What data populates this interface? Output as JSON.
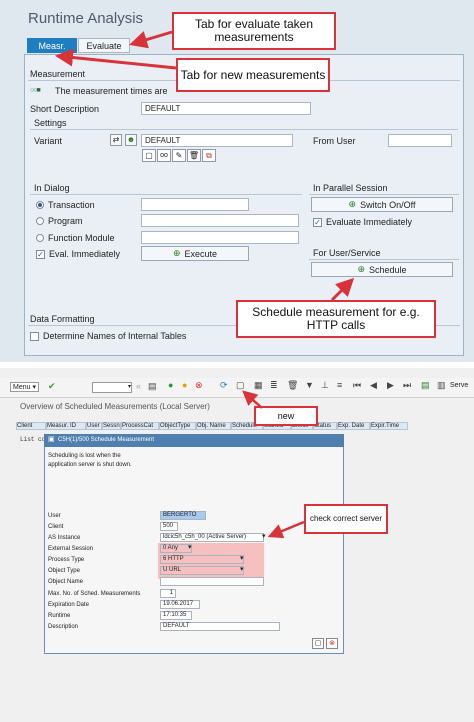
{
  "top_panel": {
    "title": "Runtime Analysis",
    "tabs": [
      {
        "label": "Measr."
      },
      {
        "label": "Evaluate"
      }
    ],
    "measurement": {
      "frame_title": "Measurement",
      "message": "The measurement times are",
      "short_description_label": "Short Description",
      "short_description_value": "DEFAULT",
      "settings_title": "Settings",
      "variant_label": "Variant",
      "variant_value": "DEFAULT",
      "from_user_label": "From User",
      "from_user_value": ""
    },
    "in_dialog": {
      "title": "In Dialog",
      "options": [
        {
          "label": "Transaction"
        },
        {
          "label": "Program"
        },
        {
          "label": "Function Module"
        }
      ],
      "selected_option": "Transaction",
      "eval_immediately_label": "Eval. Immediately",
      "eval_immediately_checked": true,
      "execute_label": "Execute"
    },
    "in_parallel": {
      "title": "In Parallel Session",
      "switch_label": "Switch On/Off",
      "evaluate_immediately_label": "Evaluate Immediately",
      "evaluate_immediately_checked": true
    },
    "user_service": {
      "title": "For User/Service",
      "schedule_label": "Schedule"
    },
    "data_formatting": {
      "title": "Data Formatting",
      "internal_tables_label": "Determine Names of Internal Tables",
      "internal_tables_checked": false
    }
  },
  "callouts": {
    "evaluate": "Tab for evaluate taken measurements",
    "new_measurements": "Tab for new measurements",
    "schedule": "Schedule measurement for e.g. HTTP calls",
    "new": "new",
    "check_server": "check correct server"
  },
  "bottom_panel": {
    "menu_label": "Menu",
    "serve_label": "Serve",
    "overview_title": "Overview of Scheduled Measurements (Local Server)",
    "columns": [
      "Client",
      "Measur. ID",
      "User",
      "Sessn",
      "ProcessCat",
      "ObjectType",
      "Obj. Name",
      "Schedule",
      "Started",
      "Execs",
      "Status",
      "Exp. Date",
      "Expir.Time"
    ],
    "empty_message": "List contains no data",
    "dialog": {
      "title": "C5H(1)/500 Schedule Measurement",
      "info_line1": "Scheduling is lost when the",
      "info_line2": "application server is shut down.",
      "fields": [
        {
          "label": "User",
          "value": "BERGERTO"
        },
        {
          "label": "Client",
          "value": "500"
        },
        {
          "label": "AS Instance",
          "value": "ldcic5h_c5h_00 (Active Server)"
        },
        {
          "label": "External Session",
          "value": "0 Any"
        },
        {
          "label": "Process Type",
          "value": "6 HTTP"
        },
        {
          "label": "Object Type",
          "value": "U URL"
        },
        {
          "label": "Object Name",
          "value": ""
        },
        {
          "label": "Max. No. of Sched. Measurements",
          "value": "1"
        },
        {
          "label": "Expiration Date",
          "value": "19.06.2017"
        },
        {
          "label": "Runtime",
          "value": "17:10:35"
        },
        {
          "label": "Description",
          "value": "DEFAULT"
        }
      ]
    }
  },
  "colors": {
    "accent_tab": "#1f7ec2",
    "callout_border": "#d9323a",
    "highlight": "#f6c0c0"
  }
}
